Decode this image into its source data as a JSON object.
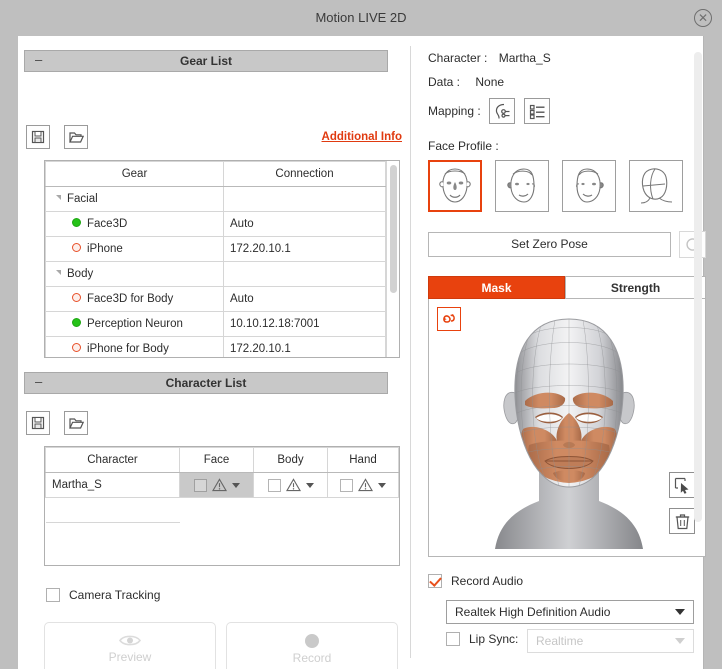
{
  "window": {
    "title": "Motion LIVE 2D",
    "close_icon": "close-circle-icon"
  },
  "left": {
    "gear_section": {
      "header": "Gear List",
      "collapse_glyph": "–",
      "save_icon": "save-icon",
      "open_icon": "open-folder-icon",
      "additional_info": "Additional Info",
      "columns": [
        "Gear",
        "Connection"
      ],
      "rows": [
        {
          "type": "group",
          "label": "Facial",
          "connection": "",
          "status": ""
        },
        {
          "type": "item",
          "label": "Face3D",
          "connection": "Auto",
          "status": "on"
        },
        {
          "type": "item",
          "label": "iPhone",
          "connection": "172.20.10.1",
          "status": "off"
        },
        {
          "type": "group",
          "label": "Body",
          "connection": "",
          "status": ""
        },
        {
          "type": "item",
          "label": "Face3D for Body",
          "connection": "Auto",
          "status": "off"
        },
        {
          "type": "item",
          "label": "Perception Neuron",
          "connection": "10.10.12.18:7001",
          "status": "on"
        },
        {
          "type": "item",
          "label": "iPhone for Body",
          "connection": "172.20.10.1",
          "status": "off"
        }
      ]
    },
    "character_section": {
      "header": "Character List",
      "collapse_glyph": "–",
      "save_icon": "save-icon",
      "open_icon": "open-folder-icon",
      "columns": [
        "Character",
        "Face",
        "Body",
        "Hand"
      ],
      "rows": [
        {
          "name": "Martha_S",
          "face": {
            "checked": false,
            "selected": true,
            "icon": "warning-triangle-icon"
          },
          "body": {
            "checked": false,
            "selected": false,
            "icon": "warning-triangle-icon"
          },
          "hand": {
            "checked": false,
            "selected": false,
            "icon": "warning-triangle-icon"
          }
        }
      ]
    },
    "camera_tracking": {
      "label": "Camera Tracking",
      "checked": false
    },
    "preview_button": {
      "label": "Preview",
      "icon": "eye-icon",
      "enabled": false
    },
    "record_button": {
      "label": "Record",
      "icon": "record-dot-icon",
      "enabled": false
    }
  },
  "right": {
    "character_label": "Character :",
    "character_value": "Martha_S",
    "data_label": "Data :",
    "data_value": "None",
    "mapping_label": "Mapping :",
    "mapping_buttons": [
      "head-mapping-icon",
      "list-mapping-icon"
    ],
    "face_profile_label": "Face Profile :",
    "face_profiles": [
      {
        "icon": "face-front-icon",
        "selected": true
      },
      {
        "icon": "face-three-quarter-left-icon",
        "selected": false
      },
      {
        "icon": "face-three-quarter-right-icon",
        "selected": false
      },
      {
        "icon": "face-wireframe-icon",
        "selected": false
      }
    ],
    "set_zero_pose": "Set Zero Pose",
    "reset_icon": "refresh-icon",
    "tabs": [
      {
        "label": "Mask",
        "active": true
      },
      {
        "label": "Strength",
        "active": false
      }
    ],
    "mask_panel": {
      "rotate_icon": "rotate-mask-icon",
      "select_icon": "marquee-select-icon",
      "delete_icon": "trash-icon",
      "head_mesh_icon": "head-mesh-preview",
      "mask_color": "#c9835e"
    },
    "record_audio": {
      "label": "Record Audio",
      "checked": true
    },
    "audio_device": "Realtek High Definition Audio",
    "lip_sync": {
      "label": "Lip Sync:",
      "checked": false,
      "value": "Realtime",
      "enabled": false
    }
  },
  "colors": {
    "accent": "#e8420e",
    "link": "#e03a10",
    "status_on": "#25c218",
    "status_off": "#e8502a",
    "titlebar": "#bfbfbf"
  }
}
